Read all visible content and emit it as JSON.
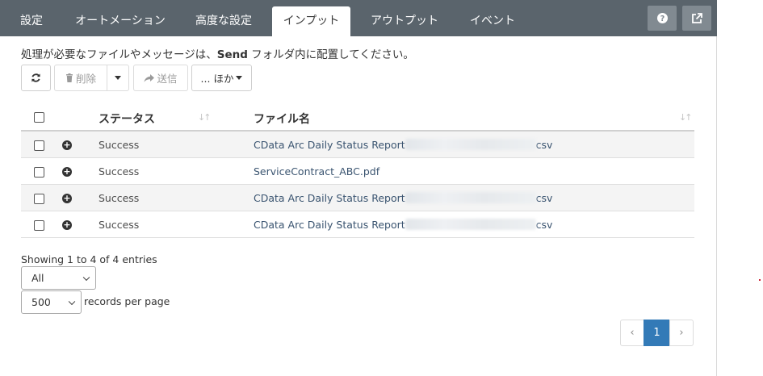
{
  "tabs": [
    {
      "label": "設定",
      "active": false
    },
    {
      "label": "オートメーション",
      "active": false
    },
    {
      "label": "高度な設定",
      "active": false
    },
    {
      "label": "インプット",
      "active": true
    },
    {
      "label": "アウトプット",
      "active": false
    },
    {
      "label": "イベント",
      "active": false
    }
  ],
  "header_buttons": {
    "help_icon": "question-circle-icon",
    "open_icon": "external-link-icon"
  },
  "instruction": {
    "prefix": "処理が必要なファイルやメッセージは、",
    "bold": "Send",
    "suffix": " フォルダ内に配置してください。"
  },
  "toolbar": {
    "refresh_icon": "refresh-icon",
    "delete_label": "削除",
    "send_label": "送信",
    "more_label": "... ほか"
  },
  "table": {
    "columns": [
      "ステータス",
      "ファイル名"
    ],
    "rows": [
      {
        "status": "Success",
        "file_prefix": "CData Arc Daily Status Report",
        "file_suffix": "csv",
        "redacted": true
      },
      {
        "status": "Success",
        "file_prefix": "ServiceContract_ABC.pdf",
        "file_suffix": "",
        "redacted": false
      },
      {
        "status": "Success",
        "file_prefix": "CData Arc Daily Status Report",
        "file_suffix": "csv",
        "redacted": true
      },
      {
        "status": "Success",
        "file_prefix": "CData Arc Daily Status Report",
        "file_suffix": "csv",
        "redacted": true
      }
    ]
  },
  "footer": {
    "showing": "Showing 1 to 4 of 4 entries",
    "filter_value": "All",
    "page_size_value": "500",
    "records_per_page": "records per page"
  },
  "pagination": {
    "prev": "‹",
    "current": "1",
    "next": "›"
  },
  "colors": {
    "tabbar": "#5a646c",
    "accent": "#337ab7",
    "link": "#3a5470"
  }
}
